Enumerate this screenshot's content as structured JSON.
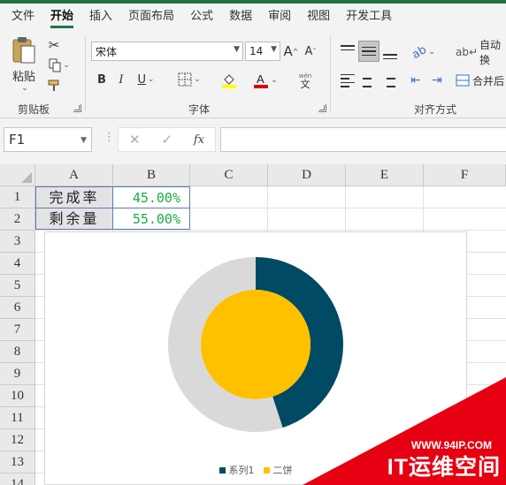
{
  "tabs": [
    "文件",
    "开始",
    "插入",
    "页面布局",
    "公式",
    "数据",
    "审阅",
    "视图",
    "开发工具"
  ],
  "active_tab": "开始",
  "ribbon": {
    "clipboard": {
      "paste_label": "粘贴",
      "group_label": "剪贴板"
    },
    "font": {
      "font_name": "宋体",
      "font_size": "14",
      "group_label": "字体",
      "bold": "B",
      "italic": "I",
      "underline": "U",
      "grow": "A",
      "shrink": "A",
      "phonetic_top": "wén",
      "phonetic_bottom": "文"
    },
    "alignment": {
      "group_label": "对齐方式",
      "wrap_label": "自动换",
      "merge_label": "合并后"
    }
  },
  "formula_bar": {
    "name_box": "F1",
    "cancel": "✕",
    "enter": "✓",
    "fx": "fx",
    "formula": ""
  },
  "columns": [
    "A",
    "B",
    "C",
    "D",
    "E",
    "F"
  ],
  "rows": [
    "1",
    "2",
    "3",
    "4",
    "5",
    "6",
    "7",
    "8",
    "9",
    "10",
    "11",
    "12",
    "13",
    "14"
  ],
  "cells": {
    "A1": "完成率",
    "B1": "45.00%",
    "A2": "剩余量",
    "B2": "55.00%"
  },
  "colors": {
    "excel_green": "#217346",
    "series_dark": "#004a63",
    "series_light": "#d9d9d9",
    "pie_gold": "#ffc000",
    "value_green": "#1ea84a",
    "watermark_red": "#e60012"
  },
  "chart_data": {
    "type": "pie",
    "subtype": "doughnut with inner pie",
    "series": [
      {
        "name": "系列1",
        "kind": "doughnut",
        "values": [
          45,
          55
        ],
        "colors": [
          "#004a63",
          "#d9d9d9"
        ]
      },
      {
        "name": "二饼",
        "kind": "pie",
        "values": [
          100
        ],
        "colors": [
          "#ffc000"
        ]
      }
    ],
    "legend": [
      "系列1",
      "二饼"
    ],
    "legend_position": "bottom",
    "title": ""
  },
  "watermark": {
    "url": "WWW.94IP.COM",
    "name": "IT运维空间"
  }
}
